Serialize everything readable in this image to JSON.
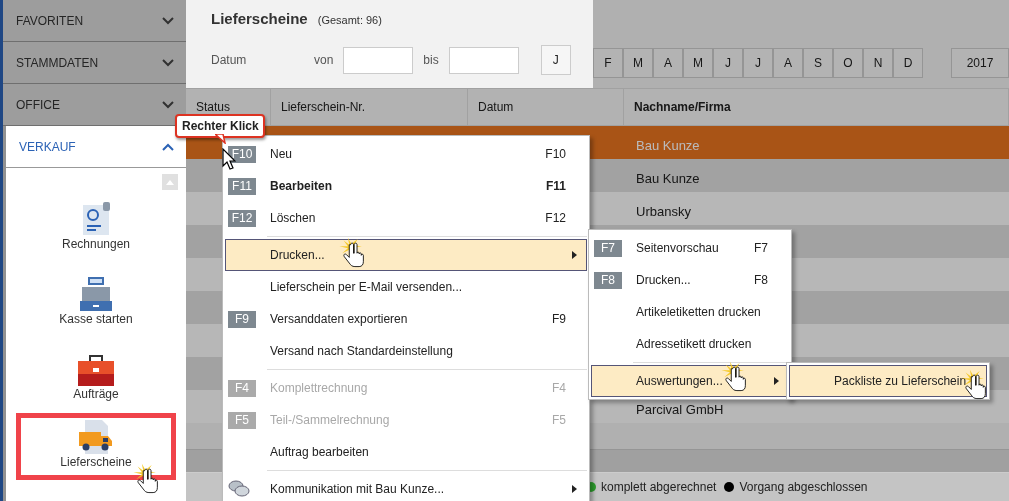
{
  "sidebar": {
    "sections": [
      {
        "label": "FAVORITEN",
        "expanded": false
      },
      {
        "label": "STAMMDATEN",
        "expanded": false
      },
      {
        "label": "OFFICE",
        "expanded": false
      },
      {
        "label": "VERKAUF",
        "expanded": true,
        "items": [
          {
            "label": "Rechnungen",
            "kind": "invoice",
            "highlighted": false
          },
          {
            "label": "Kasse starten",
            "kind": "register",
            "highlighted": false
          },
          {
            "label": "Aufträge",
            "kind": "orders",
            "highlighted": false
          },
          {
            "label": "Lieferscheine",
            "kind": "delivery",
            "highlighted": true
          }
        ]
      }
    ]
  },
  "header": {
    "title": "Lieferscheine",
    "count": "(Gesamt: 96)",
    "date_label": "Datum",
    "from_label": "von",
    "to_label": "bis",
    "months": [
      "J",
      "F",
      "M",
      "A",
      "M",
      "J",
      "J",
      "A",
      "S",
      "O",
      "N",
      "D"
    ],
    "year": "2017"
  },
  "table": {
    "columns": [
      "Status",
      "Lieferschein-Nr.",
      "Datum",
      "Nachname/Firma"
    ],
    "rows": [
      {
        "name": "Bau Kunze",
        "selected": true
      },
      {
        "name": "Bau Kunze",
        "selected": false
      },
      {
        "name": "Urbansky",
        "selected": false
      },
      {
        "selected": false
      },
      {
        "selected": false
      },
      {
        "selected": false
      },
      {
        "selected": false
      },
      {
        "selected": false
      },
      {
        "name": "Parcival GmbH",
        "selected": false
      }
    ]
  },
  "legend": [
    {
      "label": "komplett abgerechnet",
      "color": "#2e9e2e"
    },
    {
      "label": "Vorgang abgeschlossen",
      "color": "#000000"
    }
  ],
  "callout": "Rechter Klick",
  "context_menu": {
    "items": [
      {
        "kind": "item",
        "key": "F10",
        "label": "Neu",
        "shortcut": "F10",
        "bold": false,
        "disabled": false,
        "highlighted": false,
        "submenu": false
      },
      {
        "kind": "item",
        "key": "F11",
        "label": "Bearbeiten",
        "shortcut": "F11",
        "bold": true,
        "disabled": false,
        "highlighted": false,
        "submenu": false
      },
      {
        "kind": "item",
        "key": "F12",
        "label": "Löschen",
        "shortcut": "F12",
        "bold": false,
        "disabled": false,
        "highlighted": false,
        "submenu": false
      },
      {
        "kind": "separator"
      },
      {
        "kind": "item",
        "label": "Drucken...",
        "bold": false,
        "disabled": false,
        "highlighted": true,
        "submenu": true
      },
      {
        "kind": "item",
        "label": "Lieferschein per E-Mail versenden...",
        "bold": false,
        "disabled": false,
        "highlighted": false,
        "submenu": false
      },
      {
        "kind": "item",
        "key": "F9",
        "label": "Versanddaten exportieren",
        "shortcut": "F9",
        "bold": false,
        "disabled": false,
        "highlighted": false,
        "submenu": false
      },
      {
        "kind": "item",
        "label": "Versand nach Standardeinstellung",
        "bold": false,
        "disabled": false,
        "highlighted": false,
        "submenu": false
      },
      {
        "kind": "separator"
      },
      {
        "kind": "item",
        "key": "F4",
        "label": "Komplettrechnung",
        "shortcut": "F4",
        "bold": false,
        "disabled": true,
        "highlighted": false,
        "submenu": false
      },
      {
        "kind": "item",
        "key": "F5",
        "label": "Teil-/Sammelrechnung",
        "shortcut": "F5",
        "bold": false,
        "disabled": true,
        "highlighted": false,
        "submenu": false
      },
      {
        "kind": "item",
        "label": "Auftrag bearbeiten",
        "bold": false,
        "disabled": false,
        "highlighted": false,
        "submenu": false
      },
      {
        "kind": "separator"
      },
      {
        "kind": "chat",
        "label": "Kommunikation mit Bau Kunze...",
        "bold": false,
        "disabled": false,
        "highlighted": false,
        "submenu": true
      }
    ]
  },
  "print_menu": {
    "items": [
      {
        "kind": "item",
        "key": "F7",
        "label": "Seitenvorschau",
        "shortcut": "F7",
        "highlighted": false,
        "submenu": false
      },
      {
        "kind": "item",
        "key": "F8",
        "label": "Drucken...",
        "shortcut": "F8",
        "highlighted": false,
        "submenu": false
      },
      {
        "kind": "item",
        "label": "Artikeletiketten drucken",
        "highlighted": false,
        "submenu": false
      },
      {
        "kind": "item",
        "label": "Adressetikett drucken",
        "highlighted": false,
        "submenu": false
      },
      {
        "kind": "separator"
      },
      {
        "kind": "item",
        "label": "Auswertungen...",
        "highlighted": true,
        "submenu": true
      }
    ]
  },
  "reports_menu": {
    "items": [
      {
        "kind": "item",
        "label": "Packliste zu Lieferschein",
        "highlighted": true,
        "submenu": false
      }
    ]
  }
}
